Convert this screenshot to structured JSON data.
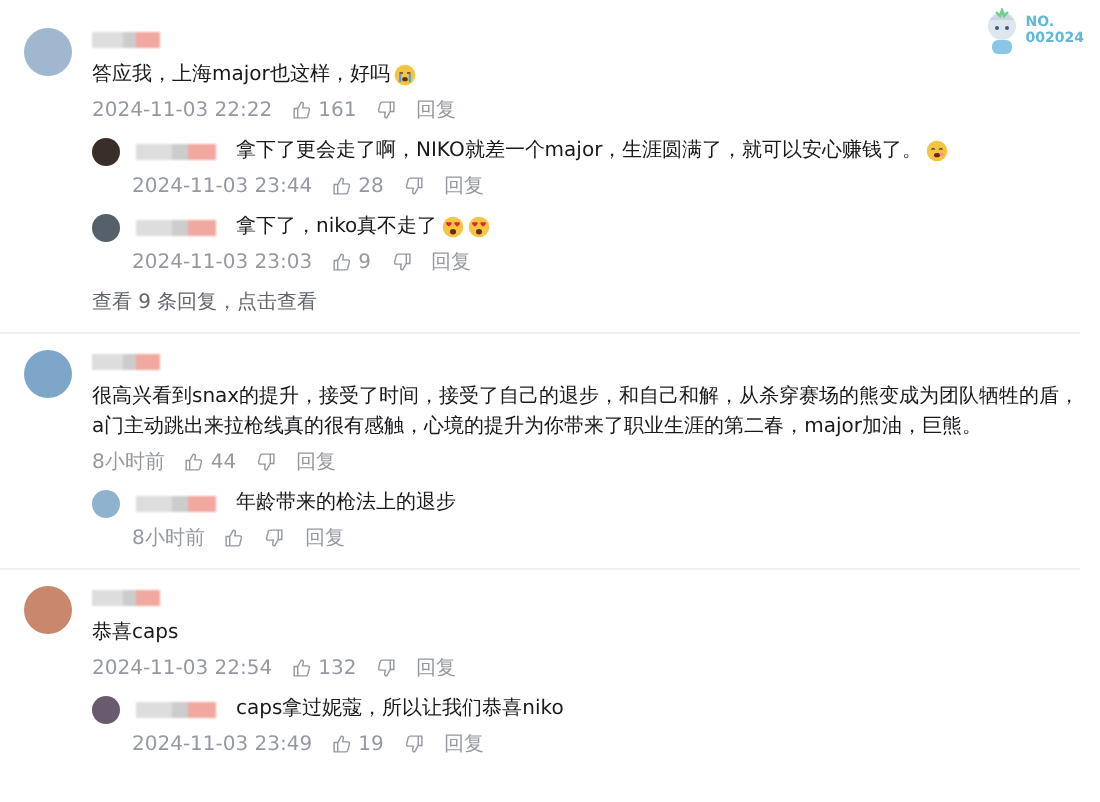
{
  "badge": {
    "lines": [
      "NO.",
      "002024"
    ]
  },
  "comments": [
    {
      "text": "答应我，上海major也这样，好吗",
      "emoji": [
        {
          "kind": "crying"
        }
      ],
      "time": "2024-11-03 22:22",
      "likes": "161",
      "reply_label": "回复",
      "replies": [
        {
          "text": "拿下了更会走了啊，NIKO就差一个major，生涯圆满了，就可以安心赚钱了。",
          "emoji": [
            {
              "kind": "drooling"
            }
          ],
          "time": "2024-11-03 23:44",
          "likes": "28",
          "reply_label": "回复"
        },
        {
          "text": "拿下了，niko真不走了",
          "emoji": [
            {
              "kind": "heart-eyes"
            },
            {
              "kind": "heart-eyes"
            }
          ],
          "time": "2024-11-03 23:03",
          "likes": "9",
          "reply_label": "回复"
        }
      ],
      "more": "查看 9 条回复，点击查看"
    },
    {
      "text": "很高兴看到snax的提升，接受了时间，接受了自己的退步，和自己和解，从杀穿赛场的熊变成为团队牺牲的盾，a门主动跳出来拉枪线真的很有感触，心境的提升为你带来了职业生涯的第二春，major加油，巨熊。",
      "time": "8小时前",
      "likes": "44",
      "reply_label": "回复",
      "replies": [
        {
          "text": "年龄带来的枪法上的退步",
          "time": "8小时前",
          "reply_label": "回复"
        }
      ]
    },
    {
      "text": "恭喜caps",
      "time": "2024-11-03 22:54",
      "likes": "132",
      "reply_label": "回复",
      "replies": [
        {
          "text": "caps拿过妮蔻，所以让我们恭喜niko",
          "time": "2024-11-03 23:49",
          "likes": "19",
          "reply_label": "回复"
        }
      ]
    }
  ]
}
